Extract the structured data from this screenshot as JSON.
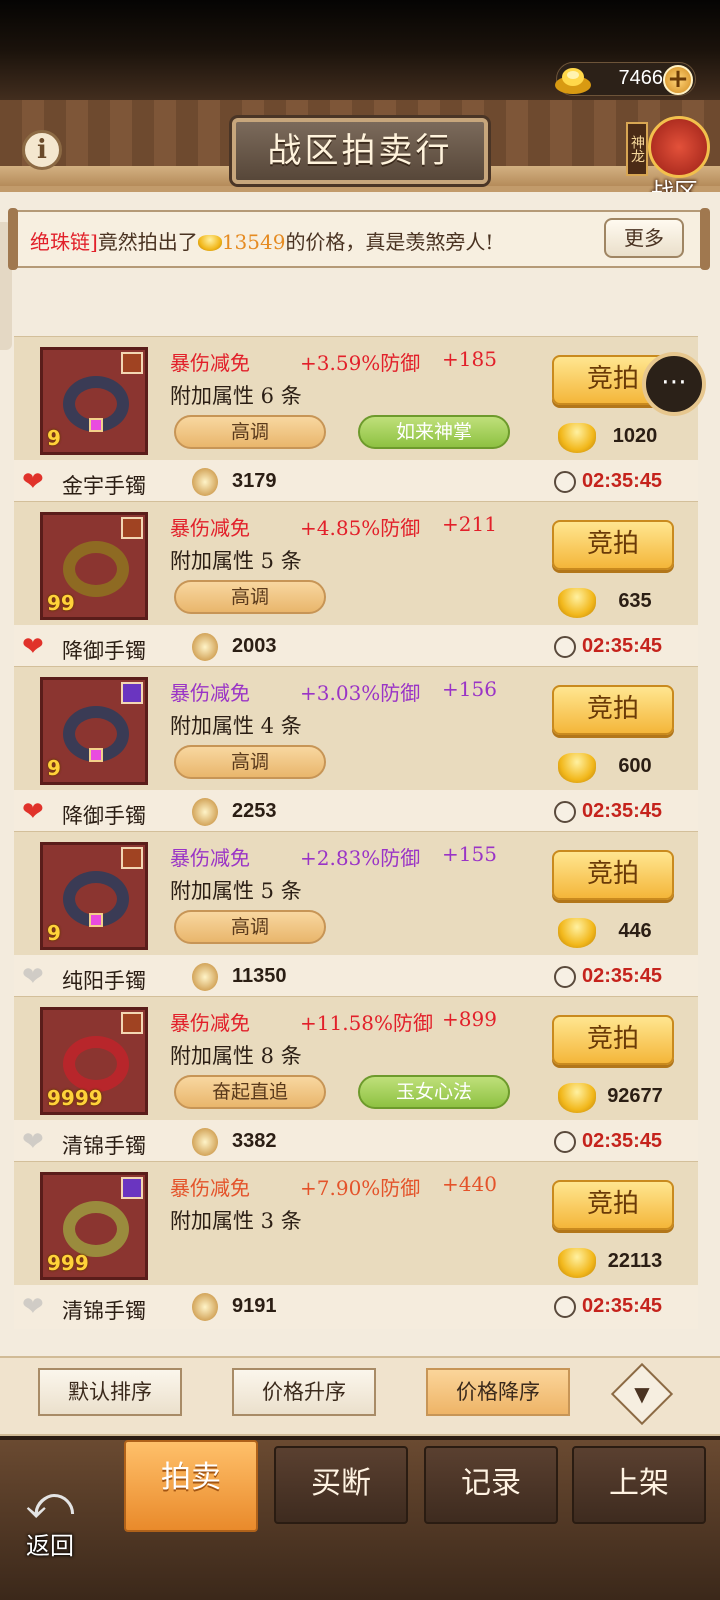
{
  "currency": {
    "gold": "7466",
    "add_icon": "plus-icon"
  },
  "header": {
    "title": "战区拍卖行",
    "server_tag": "神龙",
    "server_label": "战区"
  },
  "ticker": {
    "item_name": "绝珠链]",
    "text_before": "竟然拍出了",
    "amount": "13549",
    "text_after": "的价格，真是羡煞旁人!",
    "more_label": "更多"
  },
  "listings": [
    {
      "stat_name": "暴伤减免",
      "stat_value": "+3.59%防御",
      "stat_bonus": "+185",
      "stat_color": "red",
      "attr_text": "附加属性 6 条",
      "tag1": "高调",
      "tag2": "如来神掌",
      "bid_label": "竞拍",
      "price": "1020",
      "stars": "9",
      "ring": "dark",
      "seller_fav": true,
      "name": "金宇手镯",
      "bid_count": "3179",
      "time": "02:35:45"
    },
    {
      "stat_name": "暴伤减免",
      "stat_value": "+4.85%防御",
      "stat_bonus": "+211",
      "stat_color": "red",
      "attr_text": "附加属性 5 条",
      "tag1": "高调",
      "tag2": "",
      "bid_label": "竞拍",
      "price": "635",
      "stars": "99",
      "ring": "gold",
      "seller_fav": true,
      "name": "降御手镯",
      "bid_count": "2003",
      "time": "02:35:45"
    },
    {
      "stat_name": "暴伤减免",
      "stat_value": "+3.03%防御",
      "stat_bonus": "+156",
      "stat_color": "purple",
      "attr_text": "附加属性 4 条",
      "tag1": "高调",
      "tag2": "",
      "bid_label": "竞拍",
      "price": "600",
      "stars": "9",
      "ring": "dark",
      "seller_fav": true,
      "name": "降御手镯",
      "bid_count": "2253",
      "time": "02:35:45"
    },
    {
      "stat_name": "暴伤减免",
      "stat_value": "+2.83%防御",
      "stat_bonus": "+155",
      "stat_color": "purple",
      "attr_text": "附加属性 5 条",
      "tag1": "高调",
      "tag2": "",
      "bid_label": "竞拍",
      "price": "446",
      "stars": "9",
      "ring": "dark",
      "seller_fav": false,
      "name": "纯阳手镯",
      "bid_count": "11350",
      "time": "02:35:45"
    },
    {
      "stat_name": "暴伤减免",
      "stat_value": "+11.58%防御",
      "stat_bonus": "+899",
      "stat_color": "red",
      "attr_text": "附加属性 8 条",
      "tag1": "奋起直追",
      "tag2": "玉女心法",
      "bid_label": "竞拍",
      "price": "92677",
      "stars": "9999",
      "ring": "red",
      "seller_fav": false,
      "name": "清锦手镯",
      "bid_count": "3382",
      "time": "02:35:45"
    },
    {
      "stat_name": "暴伤减免",
      "stat_value": "+7.90%防御",
      "stat_bonus": "+440",
      "stat_color": "orange",
      "attr_text": "附加属性 3 条",
      "tag1": "",
      "tag2": "",
      "bid_label": "竞拍",
      "price": "22113",
      "stars": "999",
      "ring": "olive",
      "seller_fav": false,
      "name": "清锦手镯",
      "bid_count": "9191",
      "time": "02:35:45"
    }
  ],
  "sort": {
    "default": "默认排序",
    "asc": "价格升序",
    "desc": "价格降序",
    "active": "desc"
  },
  "tabs": [
    {
      "label": "拍卖",
      "active": true
    },
    {
      "label": "买断",
      "active": false
    },
    {
      "label": "记录",
      "active": false
    },
    {
      "label": "上架",
      "active": false
    }
  ],
  "back_label": "返回",
  "icons": {
    "info": "info-icon",
    "chat": "chat-bubble-icon",
    "filter": "filter-icon",
    "back": "back-arrow-icon",
    "heart": "heart-icon",
    "clock": "clock-icon"
  }
}
